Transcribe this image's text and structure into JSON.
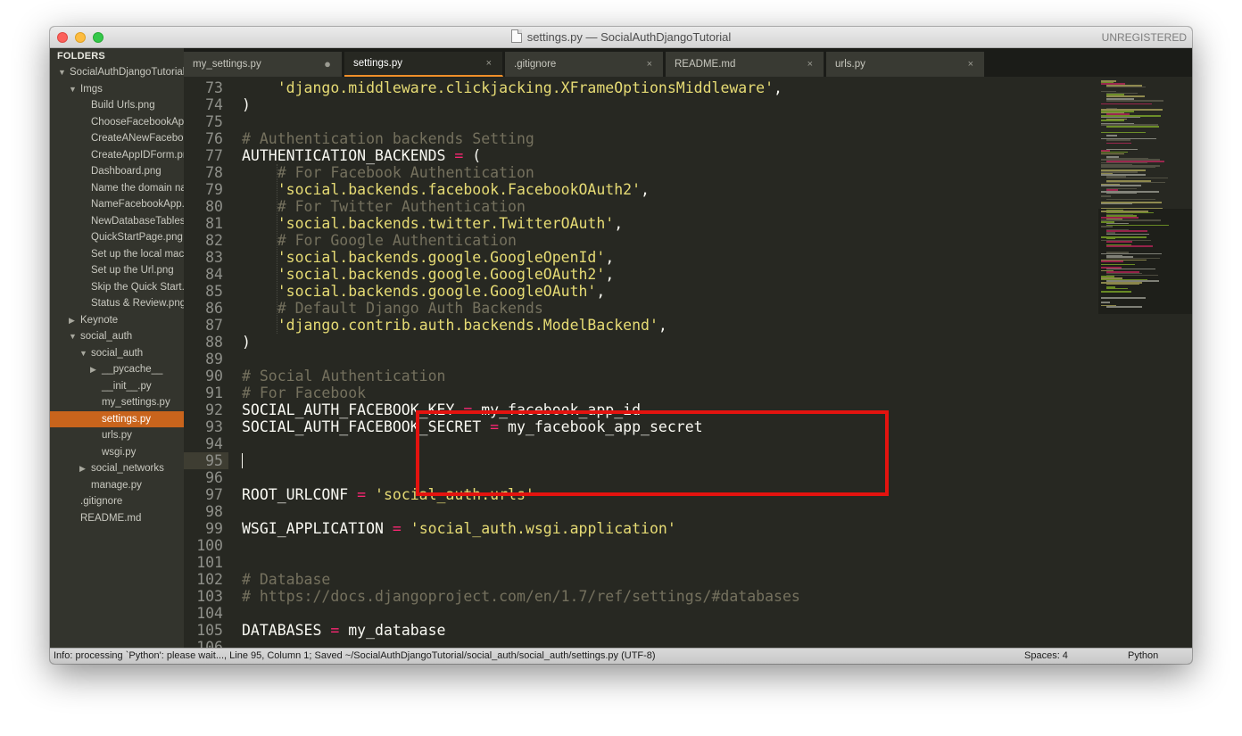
{
  "window": {
    "title": "settings.py — SocialAuthDjangoTutorial",
    "registration": "UNREGISTERED"
  },
  "sidebar": {
    "header": "FOLDERS",
    "items": [
      {
        "label": "SocialAuthDjangoTutorial",
        "depth": 0,
        "kind": "folder",
        "expanded": true
      },
      {
        "label": "Imgs",
        "depth": 1,
        "kind": "folder",
        "expanded": true
      },
      {
        "label": "Build Urls.png",
        "depth": 2,
        "kind": "file"
      },
      {
        "label": "ChooseFacebookApp.png",
        "depth": 2,
        "kind": "file"
      },
      {
        "label": "CreateANewFacebookApp.png",
        "depth": 2,
        "kind": "file"
      },
      {
        "label": "CreateAppIDForm.png",
        "depth": 2,
        "kind": "file"
      },
      {
        "label": "Dashboard.png",
        "depth": 2,
        "kind": "file"
      },
      {
        "label": "Name the domain name.png",
        "depth": 2,
        "kind": "file"
      },
      {
        "label": "NameFacebookApp.png",
        "depth": 2,
        "kind": "file"
      },
      {
        "label": "NewDatabaseTables.png",
        "depth": 2,
        "kind": "file"
      },
      {
        "label": "QuickStartPage.png",
        "depth": 2,
        "kind": "file"
      },
      {
        "label": "Set up the local machine.png",
        "depth": 2,
        "kind": "file"
      },
      {
        "label": "Set up the Url.png",
        "depth": 2,
        "kind": "file"
      },
      {
        "label": "Skip the Quick Start.png",
        "depth": 2,
        "kind": "file"
      },
      {
        "label": "Status & Review.png",
        "depth": 2,
        "kind": "file"
      },
      {
        "label": "Keynote",
        "depth": 1,
        "kind": "folder",
        "expanded": false
      },
      {
        "label": "social_auth",
        "depth": 1,
        "kind": "folder",
        "expanded": true
      },
      {
        "label": "social_auth",
        "depth": 2,
        "kind": "folder",
        "expanded": true
      },
      {
        "label": "__pycache__",
        "depth": 3,
        "kind": "folder",
        "expanded": false
      },
      {
        "label": "__init__.py",
        "depth": 3,
        "kind": "file"
      },
      {
        "label": "my_settings.py",
        "depth": 3,
        "kind": "file"
      },
      {
        "label": "settings.py",
        "depth": 3,
        "kind": "file",
        "selected": true
      },
      {
        "label": "urls.py",
        "depth": 3,
        "kind": "file"
      },
      {
        "label": "wsgi.py",
        "depth": 3,
        "kind": "file"
      },
      {
        "label": "social_networks",
        "depth": 2,
        "kind": "folder",
        "expanded": false
      },
      {
        "label": "manage.py",
        "depth": 2,
        "kind": "file"
      },
      {
        "label": ".gitignore",
        "depth": 1,
        "kind": "file"
      },
      {
        "label": "README.md",
        "depth": 1,
        "kind": "file"
      }
    ]
  },
  "tabs": [
    {
      "label": "my_settings.py",
      "dirty": true,
      "active": false,
      "button": "●"
    },
    {
      "label": "settings.py",
      "dirty": false,
      "active": true,
      "button": "×"
    },
    {
      "label": ".gitignore",
      "dirty": false,
      "active": false,
      "button": "×"
    },
    {
      "label": "README.md",
      "dirty": false,
      "active": false,
      "button": "×"
    },
    {
      "label": "urls.py",
      "dirty": false,
      "active": false,
      "button": "×"
    }
  ],
  "editor": {
    "current_line": 95,
    "lines": [
      {
        "n": "73",
        "t": [
          [
            "    ",
            ""
          ],
          [
            "'django.middleware.clickjacking.XFrameOptionsMiddleware'",
            "s"
          ],
          [
            ",",
            ""
          ]
        ]
      },
      {
        "n": "74",
        "t": [
          [
            ")",
            ""
          ]
        ]
      },
      {
        "n": "75",
        "t": []
      },
      {
        "n": "76",
        "t": [
          [
            "# Authentication backends Setting",
            "c"
          ]
        ]
      },
      {
        "n": "77",
        "t": [
          [
            "AUTHENTICATION_BACKENDS ",
            ""
          ],
          [
            "=",
            "o"
          ],
          [
            " (",
            ""
          ]
        ]
      },
      {
        "n": "78",
        "t": [
          [
            "    ",
            ""
          ],
          [
            "# For Facebook Authentication",
            "c"
          ]
        ]
      },
      {
        "n": "79",
        "t": [
          [
            "    ",
            ""
          ],
          [
            "'social.backends.facebook.FacebookOAuth2'",
            "s"
          ],
          [
            ",",
            ""
          ]
        ]
      },
      {
        "n": "80",
        "t": [
          [
            "    ",
            ""
          ],
          [
            "# For Twitter Authentication",
            "c"
          ]
        ]
      },
      {
        "n": "81",
        "t": [
          [
            "    ",
            ""
          ],
          [
            "'social.backends.twitter.TwitterOAuth'",
            "s"
          ],
          [
            ",",
            ""
          ]
        ]
      },
      {
        "n": "82",
        "t": [
          [
            "    ",
            ""
          ],
          [
            "# For Google Authentication",
            "c"
          ]
        ]
      },
      {
        "n": "83",
        "t": [
          [
            "    ",
            ""
          ],
          [
            "'social.backends.google.GoogleOpenId'",
            "s"
          ],
          [
            ",",
            ""
          ]
        ]
      },
      {
        "n": "84",
        "t": [
          [
            "    ",
            ""
          ],
          [
            "'social.backends.google.GoogleOAuth2'",
            "s"
          ],
          [
            ",",
            ""
          ]
        ]
      },
      {
        "n": "85",
        "t": [
          [
            "    ",
            ""
          ],
          [
            "'social.backends.google.GoogleOAuth'",
            "s"
          ],
          [
            ",",
            ""
          ]
        ]
      },
      {
        "n": "86",
        "t": [
          [
            "    ",
            ""
          ],
          [
            "# Default Django Auth Backends",
            "c"
          ]
        ]
      },
      {
        "n": "87",
        "t": [
          [
            "    ",
            ""
          ],
          [
            "'django.contrib.auth.backends.ModelBackend'",
            "s"
          ],
          [
            ",",
            ""
          ]
        ]
      },
      {
        "n": "88",
        "t": [
          [
            ")",
            ""
          ]
        ]
      },
      {
        "n": "89",
        "t": []
      },
      {
        "n": "90",
        "t": [
          [
            "# Social Authentication",
            "c"
          ]
        ]
      },
      {
        "n": "91",
        "t": [
          [
            "# For Facebook",
            "c"
          ]
        ]
      },
      {
        "n": "92",
        "t": [
          [
            "SOCIAL_AUTH_FACEBOOK_KEY ",
            ""
          ],
          [
            "=",
            "o"
          ],
          [
            " my_facebook_app_id",
            ""
          ]
        ]
      },
      {
        "n": "93",
        "t": [
          [
            "SOCIAL_AUTH_FACEBOOK_SECRET ",
            ""
          ],
          [
            "=",
            "o"
          ],
          [
            " my_facebook_app_secret",
            ""
          ]
        ]
      },
      {
        "n": "94",
        "t": []
      },
      {
        "n": "95",
        "t": [],
        "caret": true
      },
      {
        "n": "96",
        "t": []
      },
      {
        "n": "97",
        "t": [
          [
            "ROOT_URLCONF ",
            ""
          ],
          [
            "=",
            "o"
          ],
          [
            " ",
            ""
          ],
          [
            "'social_auth.urls'",
            "s"
          ]
        ]
      },
      {
        "n": "98",
        "t": []
      },
      {
        "n": "99",
        "t": [
          [
            "WSGI_APPLICATION ",
            ""
          ],
          [
            "=",
            "o"
          ],
          [
            " ",
            ""
          ],
          [
            "'social_auth.wsgi.application'",
            "s"
          ]
        ]
      },
      {
        "n": "100",
        "t": []
      },
      {
        "n": "101",
        "t": []
      },
      {
        "n": "102",
        "t": [
          [
            "# Database",
            "c"
          ]
        ]
      },
      {
        "n": "103",
        "t": [
          [
            "# https://docs.djangoproject.com/en/1.7/ref/settings/#databases",
            "c"
          ]
        ]
      },
      {
        "n": "104",
        "t": []
      },
      {
        "n": "105",
        "t": [
          [
            "DATABASES ",
            ""
          ],
          [
            "=",
            "o"
          ],
          [
            " my_database",
            ""
          ]
        ]
      },
      {
        "n": "106",
        "t": []
      }
    ]
  },
  "status": {
    "message": "Info: processing `Python': please wait..., Line 95, Column 1; Saved ~/SocialAuthDjangoTutorial/social_auth/social_auth/settings.py (UTF-8)",
    "spaces": "Spaces: 4",
    "syntax": "Python"
  },
  "colors": {
    "editor_bg": "#272822",
    "sidebar_bg": "#33342d",
    "selection": "#c9641c",
    "string": "#e6db74",
    "comment": "#75715e",
    "operator": "#f92672",
    "highlight_box": "#e3130f"
  }
}
